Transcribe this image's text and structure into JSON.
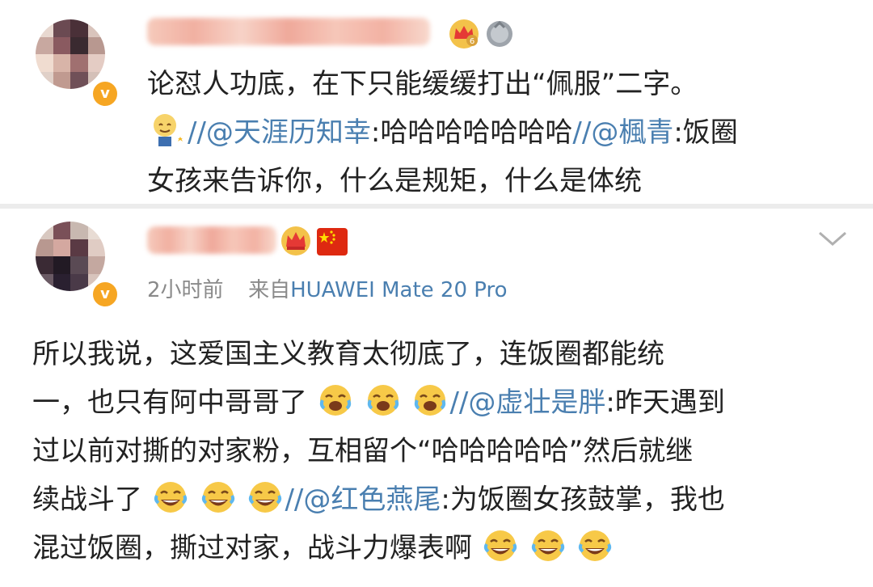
{
  "post1": {
    "line1": "论怼人功底，在下只能缓缓打出“佩服”二字。",
    "line2_sep1": "//",
    "line2_mention1": "@天涯历知幸",
    "line2_text1": ":哈哈哈哈哈哈哈",
    "line2_sep2": "//",
    "line2_mention2": "@楓青",
    "line2_text2": ":饭圈",
    "line3": "女孩来告诉你，什么是规矩，什么是体统"
  },
  "post2": {
    "time": "2小时前",
    "source_prefix": "来自",
    "device": "HUAWEI Mate 20 Pro",
    "line1": "所以我说，这爱国主义教育太彻底了，连饭圈都能统",
    "line2_text": "一，也只有阿中哥哥了",
    "line2_sep": "//",
    "line2_mention": "@虚壮是胖",
    "line2_tail": ":昨天遇到",
    "line3": "过以前对撕的对家粉，互相留个“哈哈哈哈哈”然后就继",
    "line4_text": "续战斗了",
    "line4_sep": "//",
    "line4_mention": "@红色燕尾",
    "line4_tail": ":为饭圈女孩鼓掌，我也",
    "line5_text": "混过饭圈，撕过对家，战斗力爆表啊"
  },
  "icons": {
    "crown": "crown-icon",
    "medal": "medal-icon",
    "flag": "china-flag-icon",
    "chevron": "chevron-down-icon",
    "cry_laugh": "cry-laugh-emoji",
    "laugh": "laugh-emoji",
    "sweat": "sweat-smile-emoji",
    "verified": "verified-v-badge"
  },
  "colors": {
    "mention": "#4a7fb0",
    "text": "#222222",
    "meta": "#8a8a8a",
    "badge": "#f6a623"
  }
}
